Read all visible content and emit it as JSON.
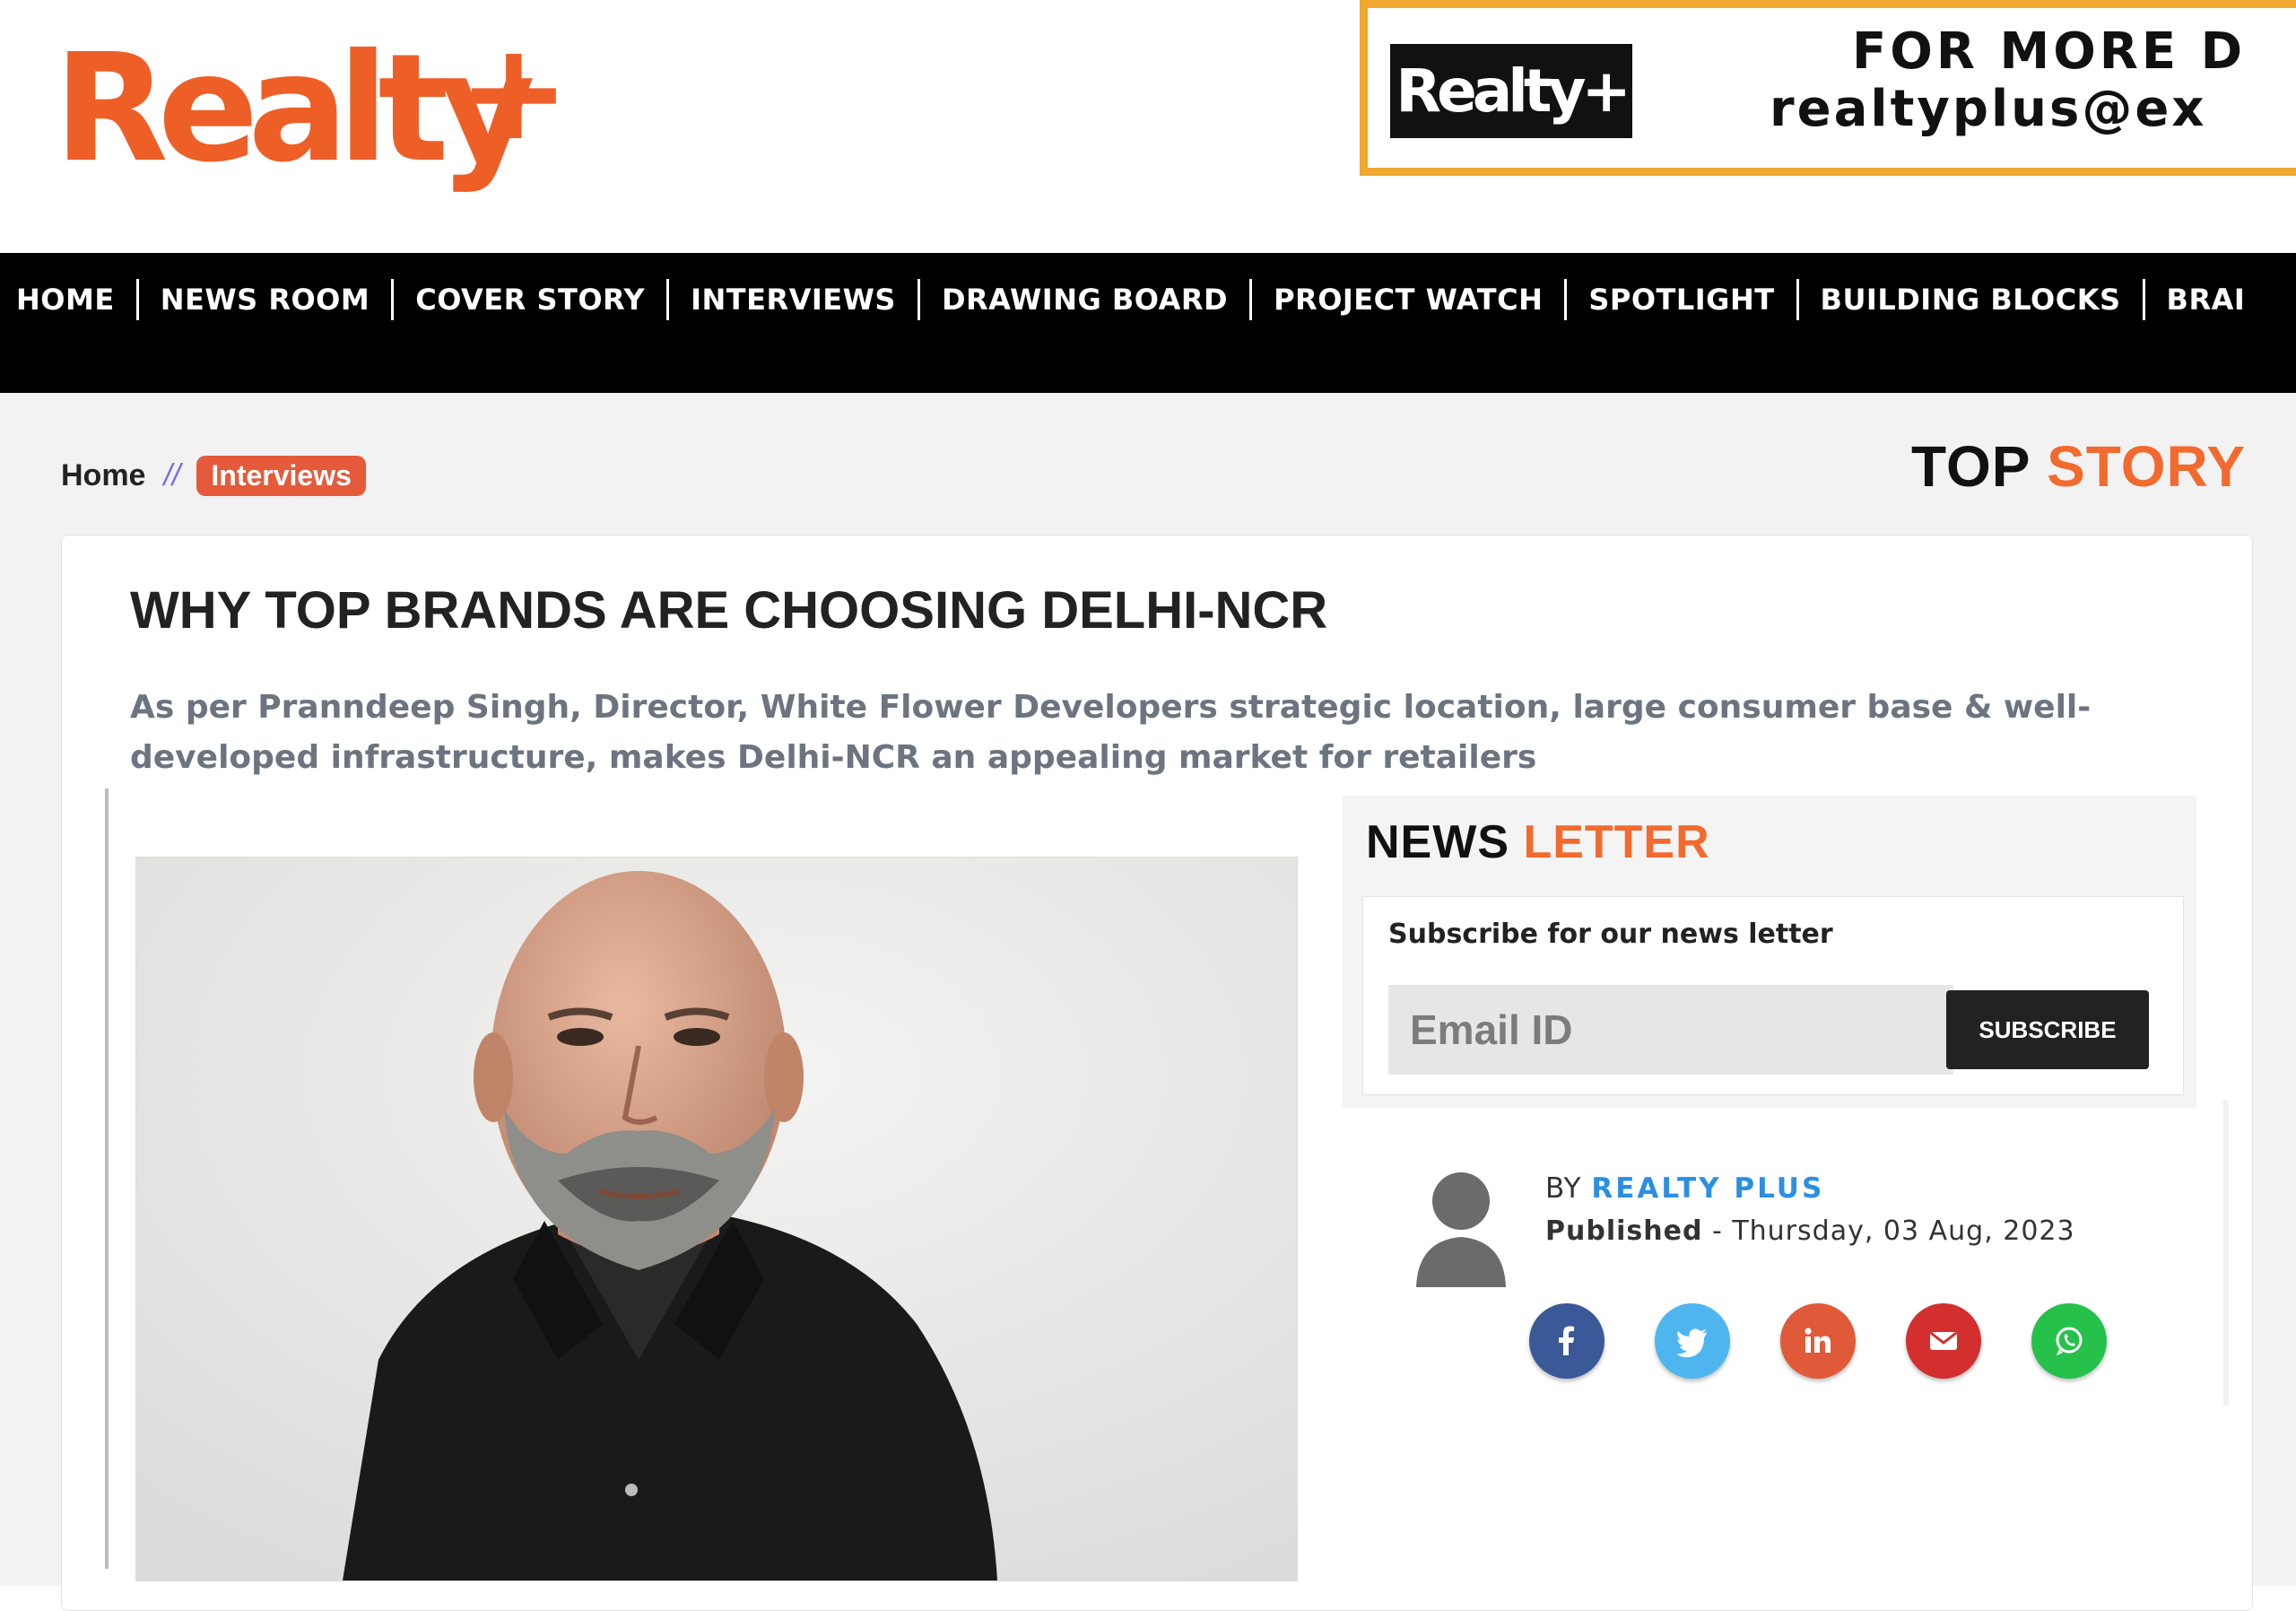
{
  "header": {
    "logo_text": "Realty",
    "logo_plus": "+",
    "ad": {
      "logo_text": "Realty+",
      "line1": "FOR MORE D",
      "line2": "realtyplus@ex",
      "border_color": "#f0a830"
    }
  },
  "nav": {
    "items": [
      {
        "label": "HOME"
      },
      {
        "label": "NEWS ROOM"
      },
      {
        "label": "COVER STORY"
      },
      {
        "label": "INTERVIEWS"
      },
      {
        "label": "DRAWING BOARD"
      },
      {
        "label": "PROJECT WATCH"
      },
      {
        "label": "SPOTLIGHT"
      },
      {
        "label": "BUILDING BLOCKS"
      },
      {
        "label": "BRAI"
      }
    ]
  },
  "breadcrumb": {
    "home": "Home",
    "separator": "//",
    "current": "Interviews"
  },
  "top_story": {
    "word1": "TOP",
    "word2": "STORY"
  },
  "article": {
    "title": "WHY TOP BRANDS ARE CHOOSING DELHI-NCR",
    "summary": "As per Pranndeep Singh, Director, White Flower Developers strategic location, large consumer base & well-developed infrastructure, makes Delhi-NCR an appealing market for retailers"
  },
  "newsletter": {
    "heading_word1": "NEWS",
    "heading_word2": "LETTER",
    "subtitle": "Subscribe for our news letter",
    "email_placeholder": "Email ID",
    "subscribe_label": "SUBSCRIBE"
  },
  "author": {
    "by_prefix": "BY",
    "name": "REALTY PLUS",
    "published_label": "Published",
    "published_date": "- Thursday, 03 Aug, 2023"
  },
  "social": [
    {
      "name": "facebook-icon",
      "color": "#3b5998"
    },
    {
      "name": "twitter-icon",
      "color": "#4fb5ee"
    },
    {
      "name": "linkedin-icon",
      "color": "#e05a3a"
    },
    {
      "name": "mail-icon",
      "color": "#d32f2f"
    },
    {
      "name": "whatsapp-icon",
      "color": "#25c14a"
    }
  ],
  "colors": {
    "brand_orange": "#ee5f28",
    "nav_bg": "#000000",
    "tag_bg": "#e55a3a",
    "link_blue": "#2b8fe3"
  }
}
